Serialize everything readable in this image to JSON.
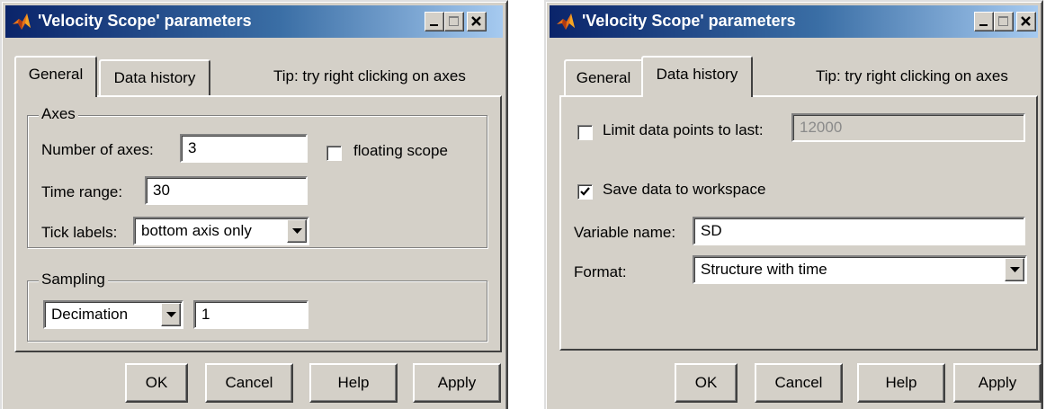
{
  "left_dialog": {
    "title": "'Velocity Scope' parameters",
    "tabs": [
      {
        "label": "General",
        "active": true
      },
      {
        "label": "Data history",
        "active": false
      }
    ],
    "tip": "Tip: try right clicking on axes",
    "axes_group": {
      "label": "Axes",
      "number_of_axes_label": "Number of axes:",
      "number_of_axes_value": "3",
      "floating_scope_label": "floating scope",
      "floating_scope_checked": false,
      "time_range_label": "Time range:",
      "time_range_value": "30",
      "tick_labels_label": "Tick labels:",
      "tick_labels_value": "bottom axis only"
    },
    "sampling_group": {
      "label": "Sampling",
      "method_value": "Decimation",
      "factor_value": "1"
    },
    "buttons": {
      "ok": "OK",
      "cancel": "Cancel",
      "help": "Help",
      "apply": "Apply"
    }
  },
  "right_dialog": {
    "title": "'Velocity Scope' parameters",
    "tabs": [
      {
        "label": "General",
        "active": false
      },
      {
        "label": "Data history",
        "active": true
      }
    ],
    "tip": "Tip: try right clicking on axes",
    "limit_points_label": "Limit data points to last:",
    "limit_points_checked": false,
    "limit_points_value": "12000",
    "save_to_workspace_label": "Save data to workspace",
    "save_to_workspace_checked": true,
    "variable_name_label": "Variable name:",
    "variable_name_value": "SD",
    "format_label": "Format:",
    "format_value": "Structure with time",
    "buttons": {
      "ok": "OK",
      "cancel": "Cancel",
      "help": "Help",
      "apply": "Apply"
    }
  },
  "icons": {
    "app_icon": "matlab-logo-icon",
    "minimize": "minimize-icon",
    "maximize": "maximize-icon",
    "close": "close-icon",
    "dropdown": "chevron-down-icon",
    "checkmark": "checkmark-icon"
  },
  "colors": {
    "face": "#d4d0c8",
    "title_start": "#0a246a",
    "title_end": "#a6caf0",
    "disabled_text": "#8a8a8a"
  }
}
